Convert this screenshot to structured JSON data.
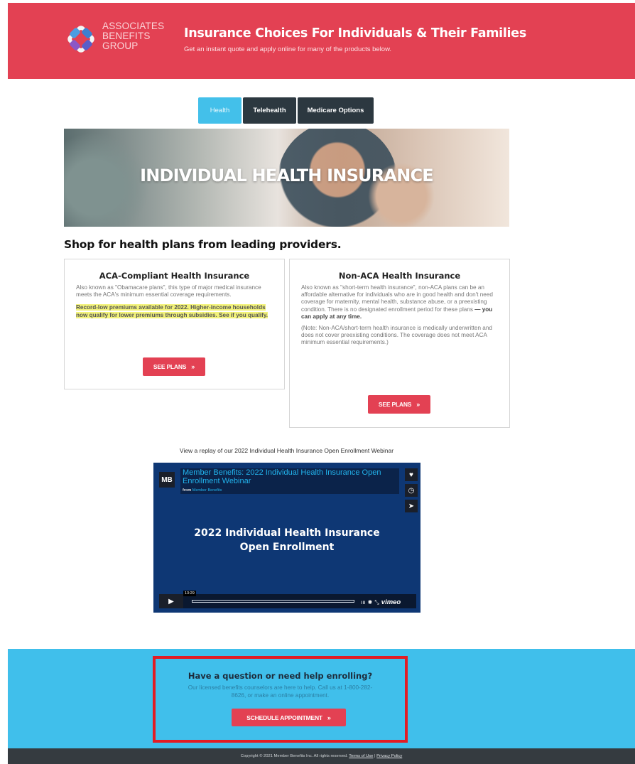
{
  "header": {
    "logo_lines": [
      "ASSOCIATES",
      "BENEFITS",
      "GROUP"
    ],
    "title": "Insurance Choices For Individuals & Their Families",
    "subtitle": "Get an instant quote and apply online for many of the products below."
  },
  "tabs": [
    {
      "label": "Health",
      "active": true
    },
    {
      "label": "Telehealth",
      "active": false
    },
    {
      "label": "Medicare Options",
      "active": false
    }
  ],
  "hero": {
    "title": "INDIVIDUAL HEALTH INSURANCE"
  },
  "shop_title": "Shop for health plans from leading providers.",
  "cards": [
    {
      "title": "ACA-Compliant Health Insurance",
      "body": "Also known as \"Obamacare plans\", this type of major medical insurance meets the ACA's minimum essential coverage requirements.",
      "highlight": "Record-low premiums available for 2022. Higher-income households now qualify for lower premiums through subsidies. See if you qualify.",
      "button": "SEE PLANS"
    },
    {
      "title": "Non-ACA Health Insurance",
      "body": "Also known as \"short-term health insurance\", non-ACA plans can be an affordable alternative for individuals who are in good health and don't need coverage for maternity, mental health, substance abuse, or a preexisting condition. There is no designated enrollment period for these plans",
      "body_bold": "— you can apply at any time.",
      "note": "(Note: Non-ACA/short-term health insurance is medically underwritten and does not cover preexisting conditions. The coverage does not meet ACA minimum essential requirements.)",
      "button": "SEE PLANS"
    }
  ],
  "video": {
    "caption": "View a replay of our 2022 Individual Health Insurance Open Enrollment Webinar",
    "badge": "MB",
    "title": "Member Benefits: 2022 Individual Health Insurance Open Enrollment Webinar",
    "from_label": "from",
    "from_name": "Member Benefits",
    "center_line1": "2022 Individual Health Insurance",
    "center_line2": "Open Enrollment",
    "time": "13:29",
    "brand": "vimeo"
  },
  "help": {
    "title": "Have a question or need help enrolling?",
    "text": "Our licensed benefits counselors are here to help. Call us at 1-800-282-8626, or make an online appointment.",
    "button": "SCHEDULE APPOINTMENT"
  },
  "footer": {
    "copyright": "Copyright © 2021 Member Benefits Inc. All rights reserved.",
    "terms": "Terms of Use",
    "sep": "|",
    "privacy": "Privacy Policy"
  },
  "colors": {
    "brand_red": "#e34153",
    "tab_dark": "#2c3840",
    "tab_active": "#43c0ea",
    "help_bg": "#40bfeb",
    "video_bg": "#0e3774"
  }
}
